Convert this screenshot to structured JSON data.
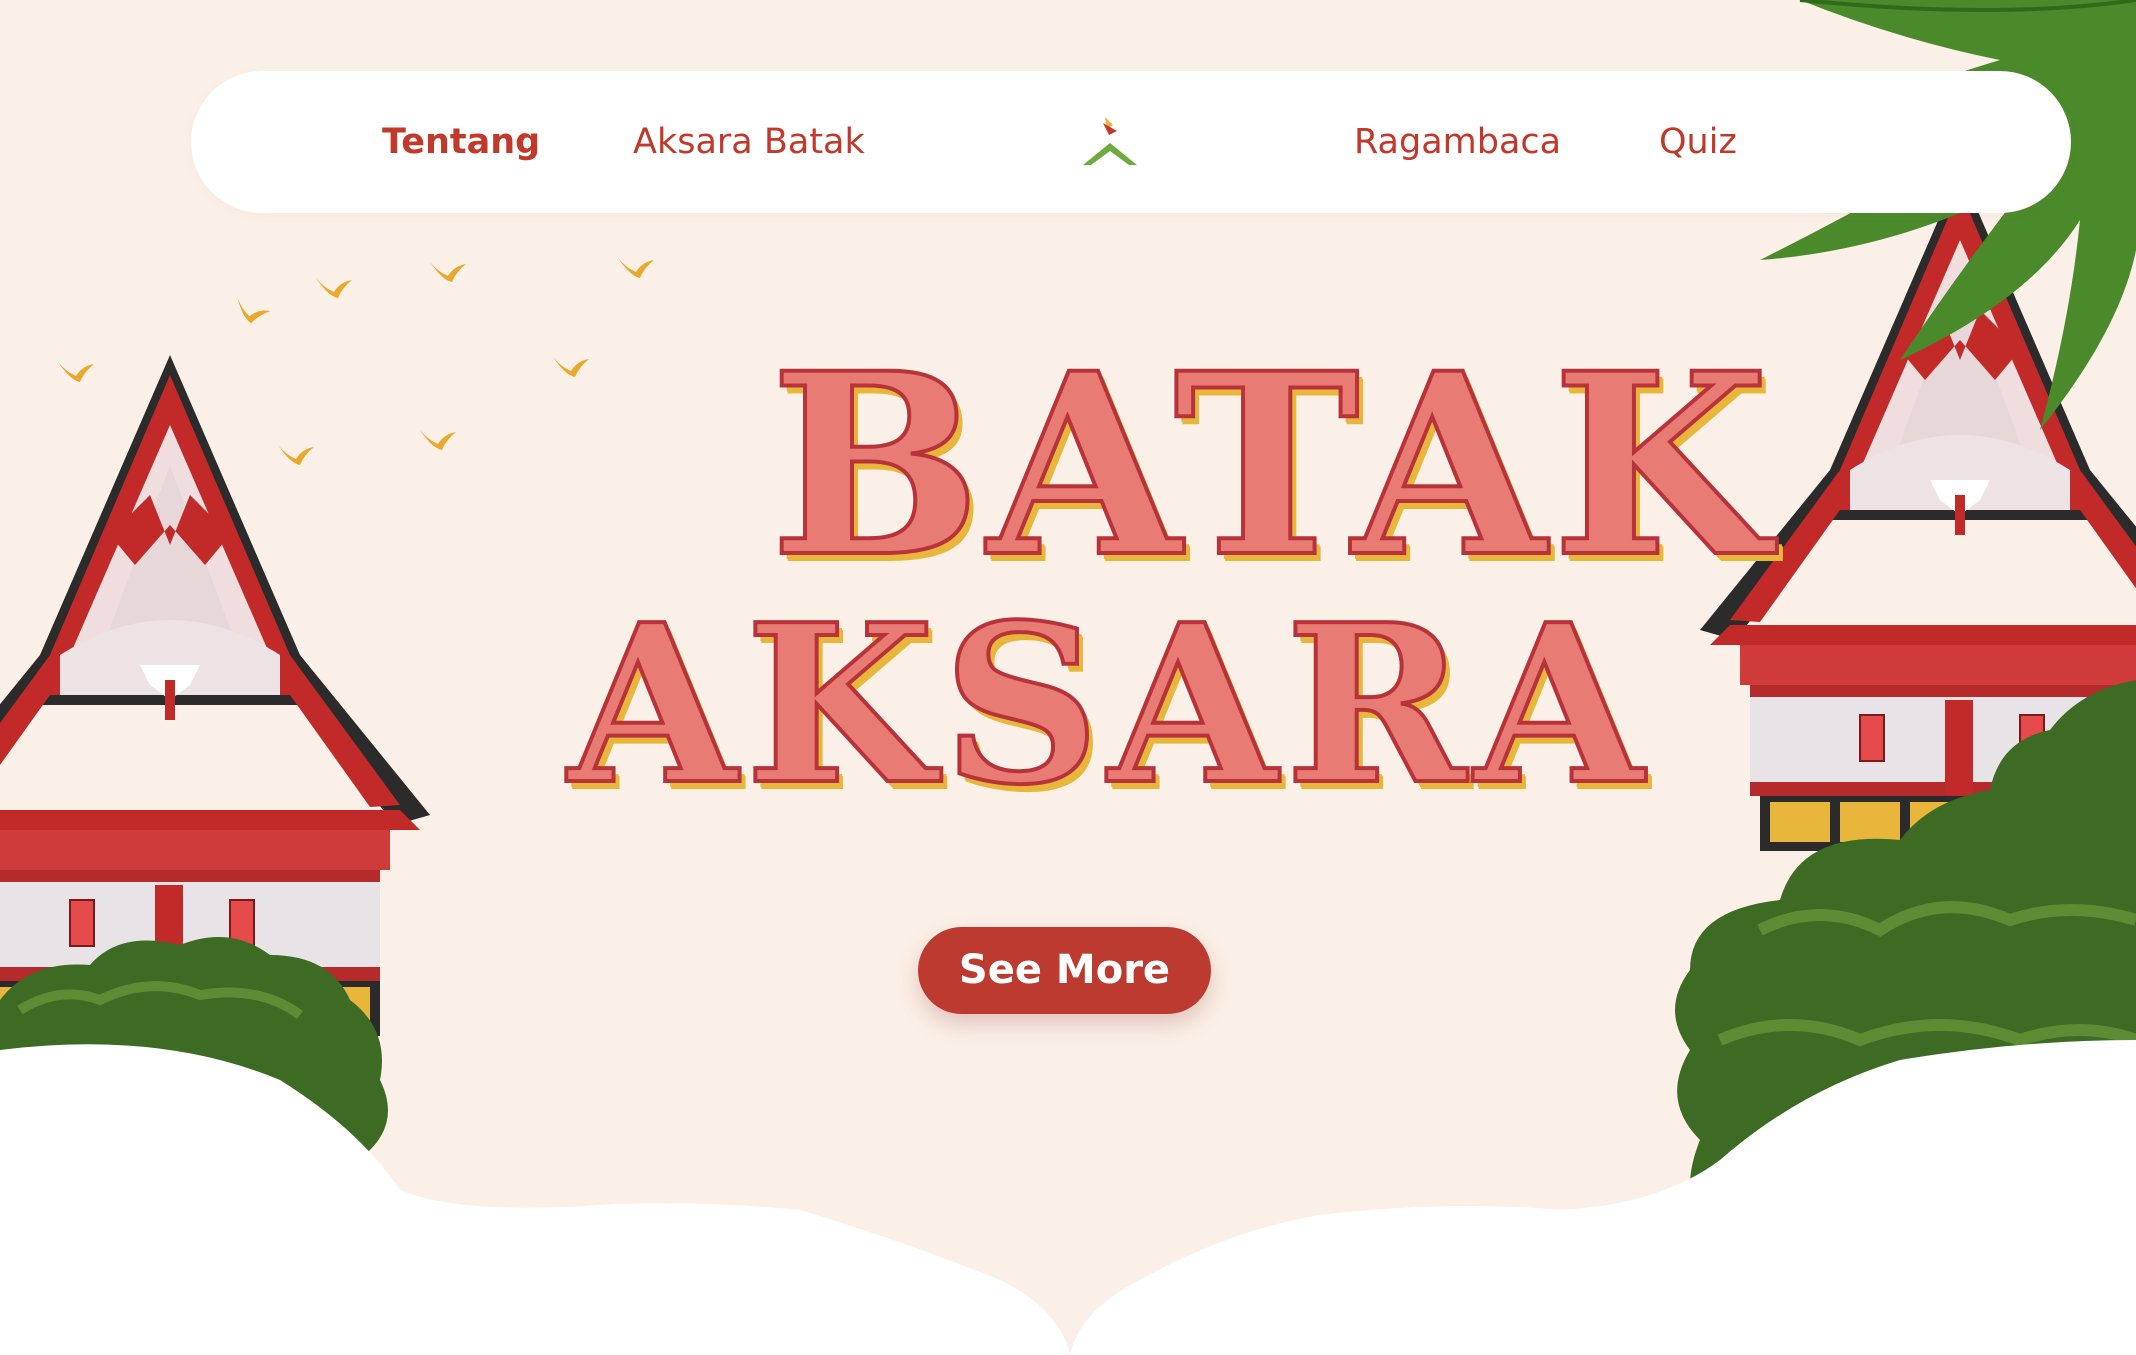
{
  "nav": {
    "items": [
      {
        "label": "Tentang",
        "active": true
      },
      {
        "label": "Aksara Batak",
        "active": false
      },
      {
        "label": "Ragambaca",
        "active": false
      },
      {
        "label": "Quiz",
        "active": false
      }
    ],
    "logo_icon": "aksara-logo-icon"
  },
  "hero": {
    "title_line1": "BATAK",
    "title_line2": "AKSARA",
    "cta_label": "See More"
  },
  "colors": {
    "background": "#fbf0e7",
    "accent_red": "#bc3a30",
    "nav_text": "#c0392b",
    "title_fill": "#e87b73",
    "title_shadow": "#e9b63c",
    "foliage": "#3d6b24"
  }
}
